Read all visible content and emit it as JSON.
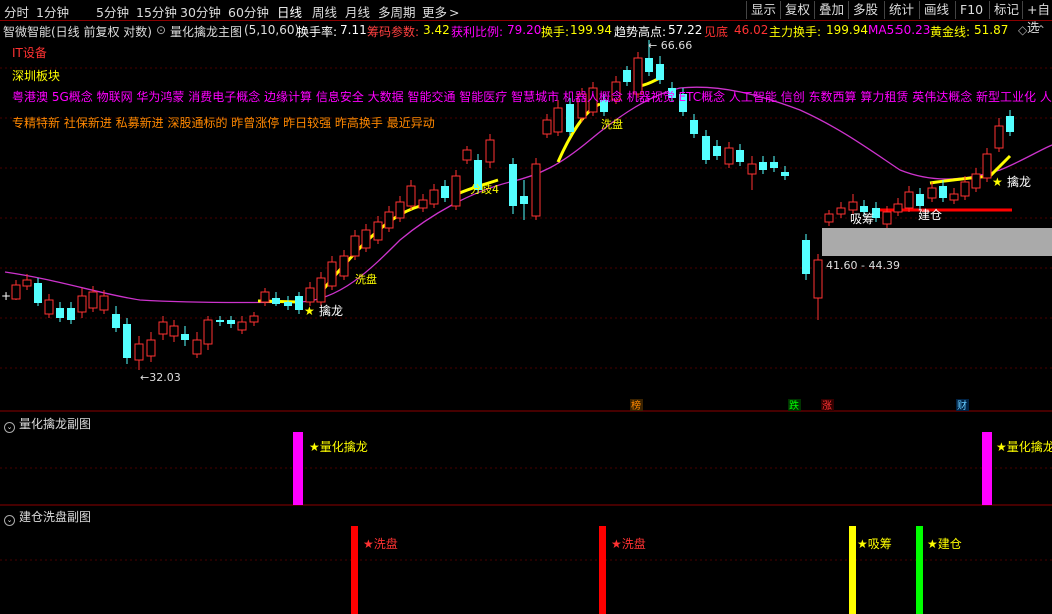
{
  "toolbar": {
    "periods": [
      "分时",
      "1分钟",
      "5分钟",
      "15分钟",
      "30分钟",
      "60分钟",
      "日线",
      "周线",
      "月线",
      "多周期",
      "更多"
    ],
    "more_arrow": ">",
    "right_buttons": [
      "显示",
      "复权",
      "叠加",
      "多股",
      "统计",
      "画线",
      "F10",
      "标记",
      "+自选"
    ]
  },
  "info": {
    "stock": "智微智能(日线 前复权 对数)",
    "indicator": "量化擒龙主图",
    "params": "(5,10,60)",
    "turnover_label": "换手率:",
    "turnover_value": "7.11",
    "chip_label": "筹码参数:",
    "chip_value": "3.42",
    "profit_label": "获利比例:",
    "profit_value": "79.20",
    "hs_label": "换手:",
    "hs_value": "199.94",
    "trend_label": "趋势高点:",
    "trend_value": "57.22",
    "low_label": "见底",
    "low_value": "46.02",
    "main_label": "主力换手:",
    "main_value": "199.94",
    "ma5_label": "MA5:",
    "ma5_value": "50.23",
    "gold_label": "黄金线:",
    "gold_value": "51.87"
  },
  "main_panel": {
    "board1": "IT设备",
    "board2": "深圳板块",
    "concepts1": "粤港澳 5G概念 物联网 华为鸿蒙 消费电子概念 边缘计算 信息安全 大数据 智能交通 智能医疗 智慧城市 机器人概念 机器视觉 ETC概念 人工智能 信创 东数西算 算力租赁 英伟达概念 新型工业化 人形机",
    "concepts2": "专精特新 社保新进 私募新进 深股通标的 昨曾涨停 昨日较强 昨高换手 最近异动",
    "high_label": "66.66",
    "low_label": "32.03",
    "range_label": "41.60 - 44.39",
    "signals": [
      "擒龙",
      "洗盘",
      "分歧4",
      "洗盘",
      "吸筹",
      "建仓",
      "擒龙"
    ],
    "bottom_tags": [
      "榜",
      "跌",
      "涨",
      "财"
    ]
  },
  "sub1": {
    "title": "量化擒龙副图",
    "marker_label": "★量化擒龙"
  },
  "sub2": {
    "title": "建仓洗盘副图",
    "labels": [
      "★洗盘",
      "★洗盘",
      "★吸筹",
      "★建仓"
    ]
  },
  "colors": {
    "up": "#ff3232",
    "down": "#54ffff",
    "ma": "#cc33cc",
    "signal": "#ffff00",
    "magenta": "#ff00ff",
    "green": "#00ff00",
    "red": "#ff0000",
    "bg": "#000000"
  },
  "chart_data": {
    "type": "candlestick",
    "price_labels": {
      "high": 66.66,
      "low": 32.03,
      "band_low": 41.6,
      "band_high": 44.39
    },
    "candles": [
      [
        27,
        0,
        0
      ],
      [
        37,
        0,
        0
      ],
      [
        48,
        0,
        0
      ],
      [
        59,
        0,
        0
      ],
      [
        70,
        0,
        0
      ],
      [
        81,
        0,
        0
      ],
      [
        93,
        0,
        0
      ],
      [
        104,
        0,
        0
      ],
      [
        115,
        0,
        0
      ],
      [
        127,
        0,
        0
      ],
      [
        138,
        0,
        0
      ],
      [
        149,
        0,
        0
      ],
      [
        160,
        0,
        0
      ],
      [
        172,
        0,
        0
      ],
      [
        183,
        0,
        0
      ],
      [
        194,
        0,
        0
      ],
      [
        206,
        0,
        0
      ],
      [
        217,
        0,
        0
      ],
      [
        228,
        0,
        0
      ],
      [
        240,
        0,
        0
      ]
    ]
  }
}
